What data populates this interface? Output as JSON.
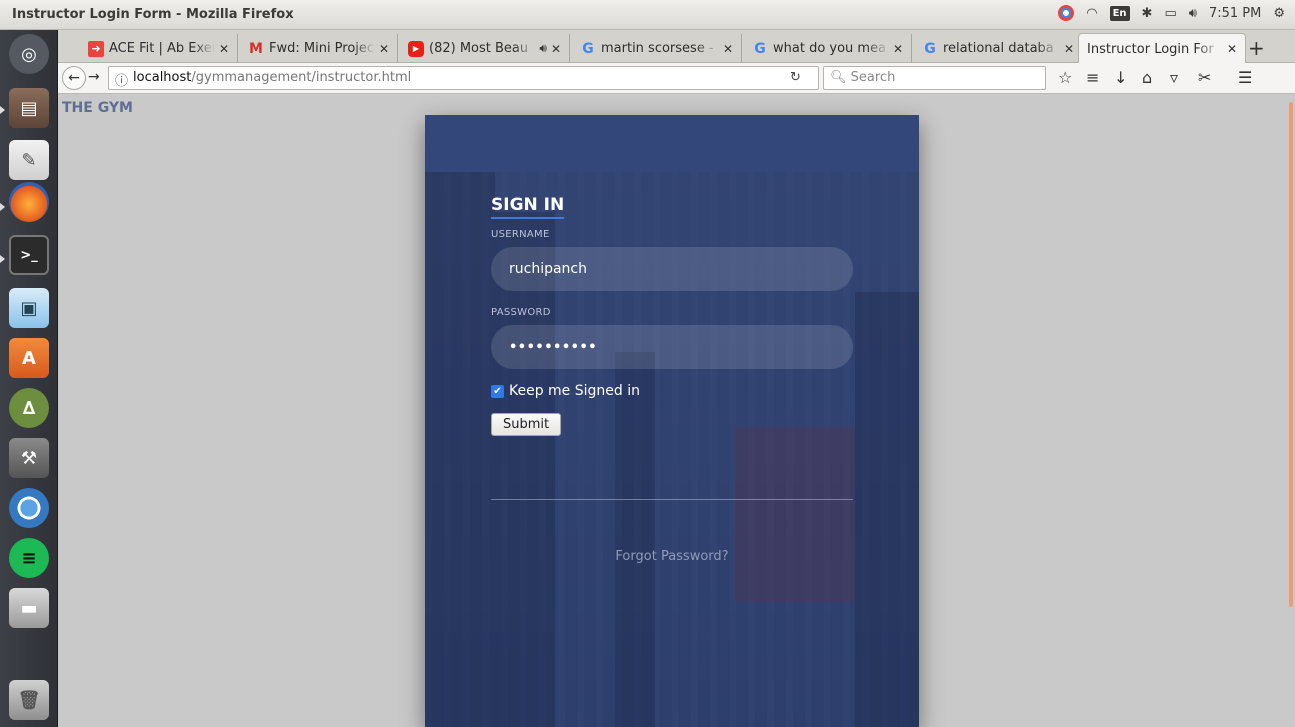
{
  "os": {
    "window_title": "Instructor Login Form - Mozilla Firefox",
    "clock": "7:51 PM",
    "keyboard_layout": "En"
  },
  "browser": {
    "tabs": [
      {
        "title": "ACE Fit | Ab Exerc",
        "favicon": "ace-fit-icon",
        "color": "#e8453c"
      },
      {
        "title": "Fwd: Mini Project",
        "favicon": "gmail-icon",
        "color": "#d93025"
      },
      {
        "title": "(82) Most Beau",
        "favicon": "youtube-icon",
        "color": "#e62117",
        "audio": "speaker-icon"
      },
      {
        "title": "martin scorsese -",
        "favicon": "google-icon",
        "color": "#4285f4"
      },
      {
        "title": "what do you mea",
        "favicon": "google-icon",
        "color": "#4285f4"
      },
      {
        "title": "relational databa",
        "favicon": "google-icon",
        "color": "#4285f4"
      },
      {
        "title": "Instructor Login For",
        "favicon": "",
        "active": true
      }
    ],
    "url_host": "localhost",
    "url_path": "/gymmanagement/instructor.html",
    "search_placeholder": "Search"
  },
  "page": {
    "brand": "THE GYM",
    "signin_title": "SIGN IN",
    "username_label": "USERNAME",
    "username_value": "ruchipanch",
    "password_label": "PASSWORD",
    "password_value": "••••••••••",
    "keep_signed_in_label": "Keep me Signed in",
    "keep_signed_in_checked": true,
    "submit_label": "Submit",
    "forgot_label": "Forgot Password?"
  }
}
